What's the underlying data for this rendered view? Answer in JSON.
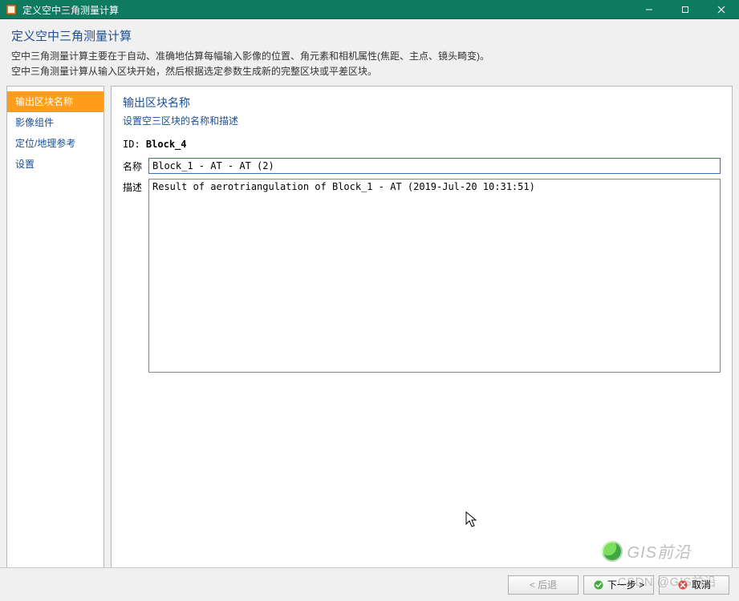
{
  "window": {
    "title": "定义空中三角测量计算"
  },
  "header": {
    "title": "定义空中三角测量计算",
    "line1": "空中三角测量计算主要在于自动、准确地估算每幅输入影像的位置、角元素和相机属性(焦距、主点、镜头畸变)。",
    "line2": "空中三角测量计算从输入区块开始，然后根据选定参数生成新的完整区块或平差区块。"
  },
  "sidebar": {
    "items": [
      {
        "label": "输出区块名称",
        "selected": true
      },
      {
        "label": "影像组件",
        "selected": false
      },
      {
        "label": "定位/地理参考",
        "selected": false
      },
      {
        "label": "设置",
        "selected": false
      }
    ]
  },
  "content": {
    "heading": "输出区块名称",
    "desc": "设置空三区块的名称和描述",
    "id_label": "ID:",
    "id_value": "Block_4",
    "name_label": "名称",
    "name_value": "Block_1 - AT - AT (2)",
    "desc_label": "描述",
    "desc_value": "Result of aerotriangulation of Block_1 - AT (2019-Jul-20 10:31:51)"
  },
  "footer": {
    "back": "< 后退",
    "next": "下一步 >",
    "cancel": "取消"
  },
  "watermark": {
    "logo_text": "GIS前沿",
    "csdn_text": "CSDN @GIS前沿"
  }
}
